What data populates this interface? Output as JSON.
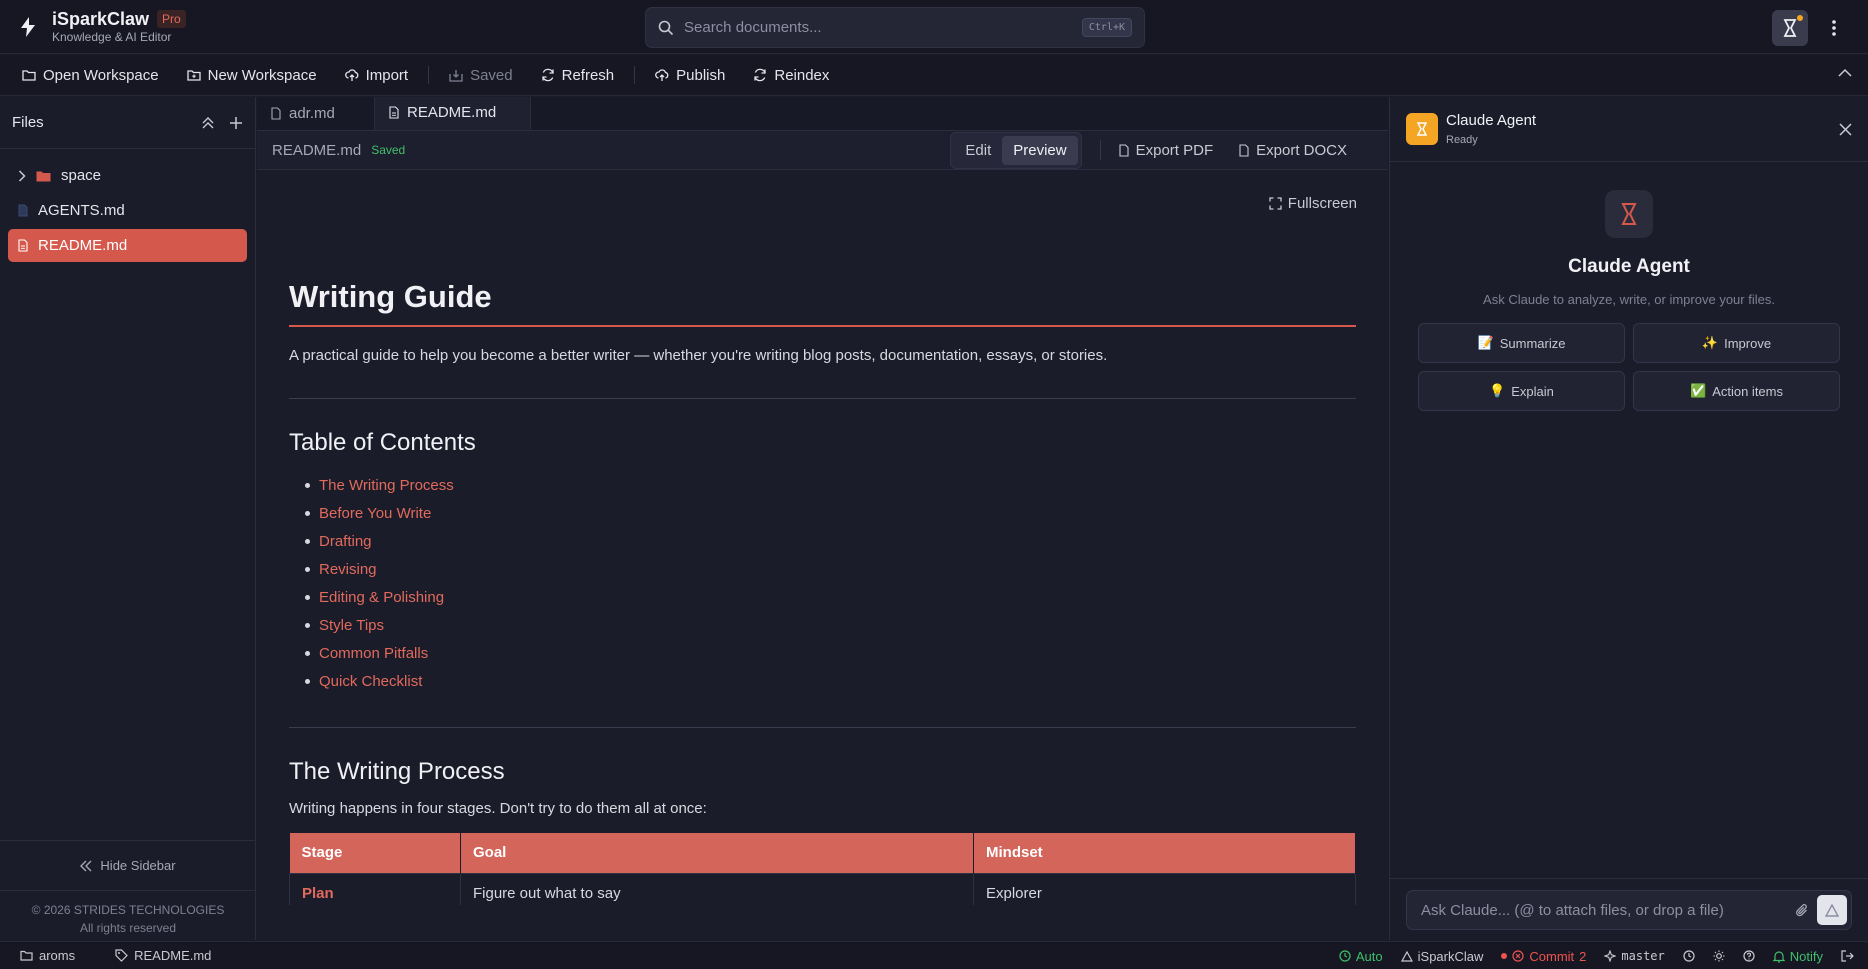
{
  "app": {
    "name": "iSparkClaw",
    "badge": "Pro",
    "subtitle": "Knowledge & AI Editor"
  },
  "search": {
    "placeholder": "Search documents...",
    "shortcut": "Ctrl+K"
  },
  "toolbar": {
    "open_workspace": "Open Workspace",
    "new_workspace": "New Workspace",
    "import": "Import",
    "saved": "Saved",
    "refresh": "Refresh",
    "publish": "Publish",
    "reindex": "Reindex"
  },
  "sidebar": {
    "title": "Files",
    "items": [
      {
        "label": "space",
        "type": "folder"
      },
      {
        "label": "AGENTS.md",
        "type": "file"
      },
      {
        "label": "README.md",
        "type": "file",
        "active": true
      }
    ],
    "hide_label": "Hide Sidebar",
    "copyright": "© 2026 STRIDES TECHNOLOGIES",
    "rights": "All rights reserved"
  },
  "tabs": [
    {
      "label": "adr.md"
    },
    {
      "label": "README.md"
    }
  ],
  "docbar": {
    "filename": "README.md",
    "status": "Saved",
    "edit": "Edit",
    "preview": "Preview",
    "export_pdf": "Export PDF",
    "export_docx": "Export DOCX"
  },
  "preview": {
    "fullscreen": "Fullscreen",
    "h1": "Writing Guide",
    "lead": "A practical guide to help you become a better writer — whether you're writing blog posts, documentation, essays, or stories.",
    "toc_title": "Table of Contents",
    "toc": [
      "The Writing Process",
      "Before You Write",
      "Drafting",
      "Revising",
      "Editing & Polishing",
      "Style Tips",
      "Common Pitfalls",
      "Quick Checklist"
    ],
    "h2_process": "The Writing Process",
    "process_intro": "Writing happens in four stages. Don't try to do them all at once:",
    "table": {
      "headers": [
        "Stage",
        "Goal",
        "Mindset"
      ],
      "rows": [
        [
          "Plan",
          "Figure out what to say",
          "Explorer"
        ]
      ]
    }
  },
  "agent": {
    "name": "Claude Agent",
    "status": "Ready",
    "title": "Claude Agent",
    "subtitle": "Ask Claude to analyze, write, or improve your files.",
    "actions": [
      {
        "emoji": "📝",
        "label": "Summarize"
      },
      {
        "emoji": "✨",
        "label": "Improve"
      },
      {
        "emoji": "💡",
        "label": "Explain"
      },
      {
        "emoji": "✅",
        "label": "Action items"
      }
    ],
    "input_placeholder": "Ask Claude... (@ to attach files, or drop a file)"
  },
  "statusbar": {
    "workspace": "aroms",
    "file": "README.md",
    "auto": "Auto",
    "app": "iSparkClaw",
    "commit_label": "Commit",
    "commit_count": "2",
    "branch": "master",
    "notify": "Notify"
  },
  "colors": {
    "accent": "#d4584c",
    "link": "#e16a5c",
    "success": "#3fbf6b",
    "agent": "#f5a524"
  }
}
